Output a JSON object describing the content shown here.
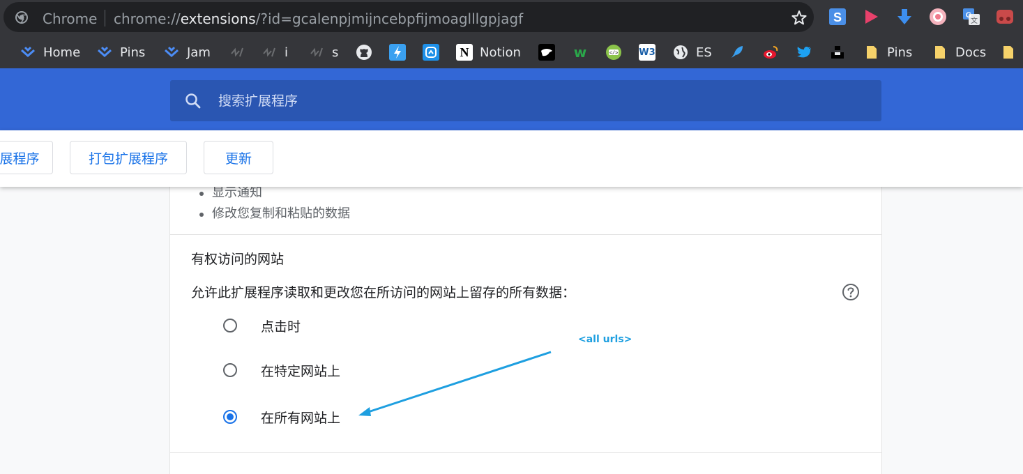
{
  "browser": {
    "site_label": "Chrome",
    "url_scheme": "chrome://",
    "url_host": "extensions",
    "url_path": "/?id=gcalenpjmijncebpfijmoaglllgpjagf"
  },
  "extensions": [
    {
      "icon": "s-letter-icon",
      "color": "#4a8fe7"
    },
    {
      "icon": "play-icon",
      "color": "#e8416b"
    },
    {
      "icon": "download-arrow-icon",
      "color": "#3d8ff0"
    },
    {
      "icon": "circle-dot-icon",
      "color": "#f07a8c"
    },
    {
      "icon": "google-translate-icon",
      "color": "#4a8fe7"
    },
    {
      "icon": "red-square-icon",
      "color": "#c94a4a"
    }
  ],
  "bookmarks": [
    {
      "label": "Home",
      "icon": "jira-icon"
    },
    {
      "label": "Pins",
      "icon": "jira-icon"
    },
    {
      "label": "Jam",
      "icon": "jira-icon"
    },
    {
      "label": "",
      "icon": "code-slash-icon"
    },
    {
      "label": "i",
      "icon": "code-slash-icon"
    },
    {
      "label": "s",
      "icon": "code-slash-icon"
    },
    {
      "label": "",
      "icon": "github-icon"
    },
    {
      "label": "",
      "icon": "lightning-icon"
    },
    {
      "label": "",
      "icon": "refresh-box-icon"
    },
    {
      "label": "Notion",
      "icon": "notion-icon"
    },
    {
      "label": "",
      "icon": "bird-icon"
    },
    {
      "label": "",
      "icon": "w-green-icon"
    },
    {
      "label": "",
      "icon": "code-badge-icon"
    },
    {
      "label": "",
      "icon": "w3-icon"
    },
    {
      "label": "ES",
      "icon": "globe-icon"
    },
    {
      "label": "",
      "icon": "rocket-icon"
    },
    {
      "label": "",
      "icon": "weibo-icon"
    },
    {
      "label": "",
      "icon": "twitter-icon"
    },
    {
      "label": "",
      "icon": "unsplash-icon"
    },
    {
      "label": "Pins",
      "icon": "folder-icon"
    },
    {
      "label": "Docs",
      "icon": "folder-icon"
    }
  ],
  "search": {
    "placeholder": "搜索扩展程序"
  },
  "toolbar": {
    "load_label": "展程序",
    "pack_label": "打包扩展程序",
    "update_label": "更新"
  },
  "card": {
    "permissions": [
      "显示通知",
      "修改您复制和粘贴的数据"
    ],
    "site_access_title": "有权访问的网站",
    "site_access_desc": "允许此扩展程序读取和更改您在所访问的网站上留存的所有数据：",
    "options": [
      {
        "label": "点击时",
        "checked": false
      },
      {
        "label": "在特定网站上",
        "checked": false
      },
      {
        "label": "在所有网站上",
        "checked": true
      }
    ]
  },
  "annotation": {
    "text": "<all urls>",
    "color": "#1e9fe0"
  }
}
